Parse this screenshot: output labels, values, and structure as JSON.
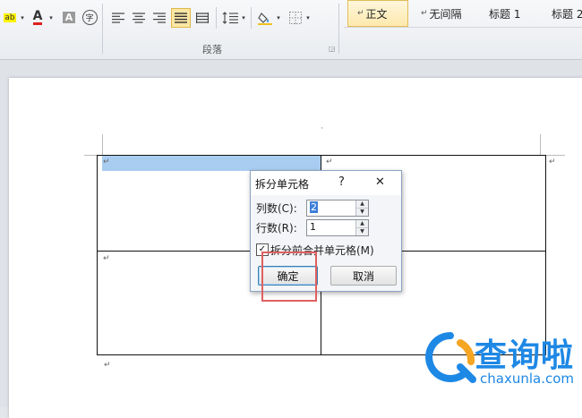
{
  "ribbon": {
    "font_group": {
      "highlight_glyph": "ab",
      "font_color_glyph": "A",
      "char_shading_glyph": "A",
      "enclosed_char_glyph": "字"
    },
    "paragraph_group_label": "段落",
    "styles": [
      {
        "mark": "↵",
        "label": "正文",
        "active": true
      },
      {
        "mark": "↵",
        "label": "无间隔",
        "active": false
      },
      {
        "mark": "",
        "label": "标题 1",
        "active": false
      },
      {
        "mark": "",
        "label": "标题 2",
        "active": false
      }
    ]
  },
  "document": {
    "para_mark": "↵",
    "header_dot": "·"
  },
  "dialog": {
    "title": "拆分单元格",
    "help": "?",
    "close": "✕",
    "columns_label": "列数(C):",
    "columns_value": "2",
    "rows_label": "行数(R):",
    "rows_value": "1",
    "merge_checkbox_label": "拆分前合并单元格(M)",
    "merge_checked": true,
    "ok_label": "确定",
    "cancel_label": "取消"
  },
  "watermark": {
    "cn": "查询啦",
    "url": "chaxunla.com"
  },
  "colors": {
    "selection": "#a9cdf0",
    "highlight_box": "#e06060",
    "watermark_blue": "#1e88e5",
    "watermark_orange": "#f5a623"
  }
}
